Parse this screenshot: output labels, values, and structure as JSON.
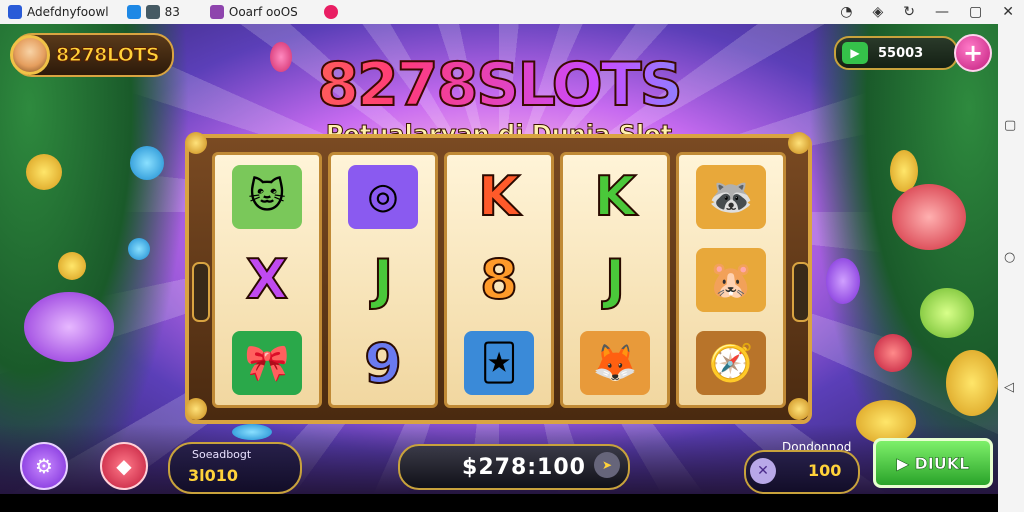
{
  "system_bar": {
    "app1_label": "Adefdnyfoowl",
    "app2_label": "83",
    "app3_label": "Ooarf ooOS",
    "colors": {
      "app1": "#2a5bd7",
      "app2": "#1e88e5",
      "app3": "#8e44ad",
      "app4": "#e91e63"
    }
  },
  "nav_buttons": {
    "square": "▢",
    "circle": "○",
    "back": "◁"
  },
  "header": {
    "logo_text": "8278LOTS",
    "balance_value": "55003",
    "add_icon": "+"
  },
  "title": {
    "main": "8278SLOTS",
    "subtitle": "Petualaryan di Dunia Slot"
  },
  "reels": [
    [
      {
        "sym": "🐱",
        "color": "#7ac85a",
        "kind": "pic",
        "name": "cat-card"
      },
      {
        "sym": "X",
        "color": "#c04af0",
        "kind": "letter",
        "name": "letter-x"
      },
      {
        "sym": "🎀",
        "color": "#2aa84a",
        "kind": "pic",
        "name": "green-ribbon"
      }
    ],
    [
      {
        "sym": "◎",
        "color": "#8a5af0",
        "kind": "pic",
        "name": "spiral"
      },
      {
        "sym": "J",
        "color": "#4ac83a",
        "kind": "letter",
        "name": "letter-j"
      },
      {
        "sym": "9",
        "color": "#6a7af0",
        "kind": "letter",
        "name": "number-9"
      }
    ],
    [
      {
        "sym": "K",
        "color": "#ff5a2a",
        "kind": "letter",
        "name": "letter-k"
      },
      {
        "sym": "8",
        "color": "#ff9a2a",
        "kind": "letter",
        "name": "number-8"
      },
      {
        "sym": "🃏",
        "color": "#3a8ad8",
        "kind": "pic",
        "name": "card"
      }
    ],
    [
      {
        "sym": "K",
        "color": "#4ac83a",
        "kind": "letter",
        "name": "letter-k-green"
      },
      {
        "sym": "J",
        "color": "#4ac83a",
        "kind": "letter",
        "name": "letter-j-green"
      },
      {
        "sym": "🦊",
        "color": "#e89a3a",
        "kind": "pic",
        "name": "fox-k"
      }
    ],
    [
      {
        "sym": "🦝",
        "color": "#e8a83a",
        "kind": "pic",
        "name": "raccoon"
      },
      {
        "sym": "🐹",
        "color": "#e8a83a",
        "kind": "pic",
        "name": "hamster"
      },
      {
        "sym": "🧭",
        "color": "#b8742a",
        "kind": "pic",
        "name": "compass"
      }
    ]
  ],
  "bottom": {
    "settings_icon": "⚙",
    "gem_icon": "◆",
    "bet_label": "Soeadbogt",
    "bet_value": "3l010",
    "win_value": "$278:100",
    "win_arrow_icon": "➤",
    "line_label": "Dondonnod",
    "line_icon": "✕",
    "line_value": "100",
    "spin_label": "▶ DIUKL"
  }
}
